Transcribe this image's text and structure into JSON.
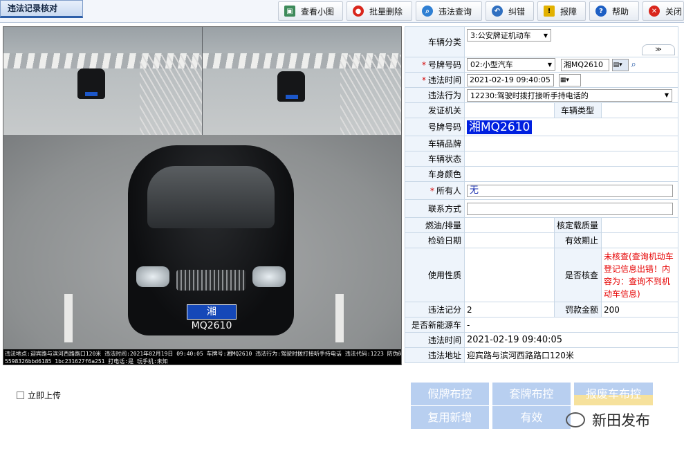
{
  "window": {
    "title": "违法记录核对"
  },
  "toolbar": {
    "buttons": [
      {
        "label": "查看小图",
        "icon": "image-icon",
        "color": "#3d8a5a"
      },
      {
        "label": "批量删除",
        "icon": "delete-icon",
        "color": "#d9261c"
      },
      {
        "label": "违法查询",
        "icon": "search-icon",
        "color": "#2f7fd3"
      },
      {
        "label": "纠错",
        "icon": "undo-icon",
        "color": "#2f6fc0"
      },
      {
        "label": "报障",
        "icon": "warning-icon",
        "color": "#e2b100"
      },
      {
        "label": "帮助",
        "icon": "help-icon",
        "color": "#1d5fc4"
      },
      {
        "label": "关闭",
        "icon": "close-icon",
        "color": "#d9261c"
      }
    ]
  },
  "photo": {
    "plate_text": "湘MQ2610",
    "caption_line1": "违法地点:迎宾路与滨河西路路口120米 违法时间:2021年02月19日 09:40:05 车牌号:湘MQ2610 违法行为:驾驶时拨打接听手持电话 违法代码:1223 防伪码:",
    "caption_line2": "5598326bbd6185 1bc231627f6a251  打电话:是  玩手机:未知"
  },
  "form": {
    "vehicle_category_label": "车辆分类",
    "vehicle_category_value": "3:公安牌证机动车",
    "plate_label": "号牌号码",
    "plate_type_value": "02:小型汽车",
    "plate_value": "湘MQ2610",
    "violation_time_label": "违法时间",
    "violation_time_value": "2021-02-19 09:40:05",
    "violation_act_label": "违法行为",
    "violation_act_value": "12230:驾驶时拨打接听手持电话的",
    "issuer_label": "发证机关",
    "vehicle_type_label": "车辆类型",
    "plate_label2": "号牌号码",
    "plate_highlight": "湘MQ2610",
    "brand_label": "车辆品牌",
    "status_label": "车辆状态",
    "color_label": "车身颜色",
    "owner_label": "所有人",
    "owner_value": "无",
    "contact_label": "联系方式",
    "fuel_label": "燃油/排量",
    "load_label": "核定载质量",
    "inspect_label": "检验日期",
    "valid_label": "有效期止",
    "usage_label": "使用性质",
    "verified_label": "是否核查",
    "verified_note": "未核查(查询机动车登记信息出错！内容为：查询不到机动车信息)",
    "points_label": "违法记分",
    "points_value": "2",
    "fine_label": "罚款金额",
    "fine_value": "200",
    "new_energy_label": "是否新能源车",
    "new_energy_value": "-",
    "time2_label": "违法时间",
    "time2_value": "2021-02-19 09:40:05",
    "place_label": "违法地址",
    "place_value": "迎宾路与滨河西路路口120米"
  },
  "actions": {
    "fake_plate": "假牌布控",
    "cloned_plate": "套牌布控",
    "scrapped": "报废车布控",
    "reuse_add": "复用新增",
    "valid": "有效"
  },
  "upload_checkbox": "立即上传",
  "watermark": "新田发布"
}
